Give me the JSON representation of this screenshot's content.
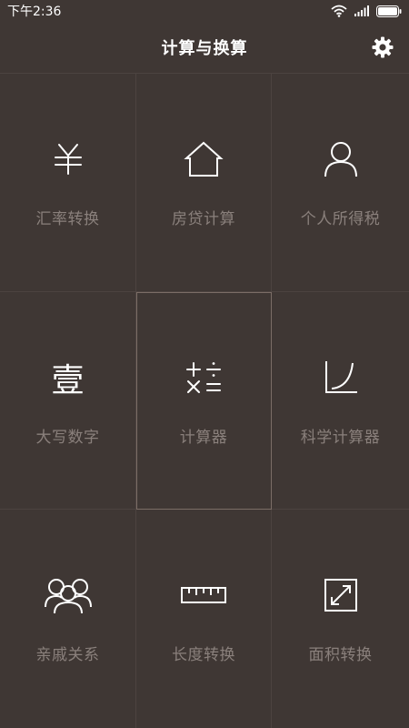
{
  "status_bar": {
    "time": "下午2:36",
    "icons": [
      "wifi-icon",
      "signal-icon",
      "battery-icon"
    ]
  },
  "header": {
    "title": "计算与换算",
    "settings_icon": "gear-icon"
  },
  "tiles": [
    {
      "label": "汇率转换",
      "icon": "yuan-icon"
    },
    {
      "label": "房贷计算",
      "icon": "house-icon"
    },
    {
      "label": "个人所得税",
      "icon": "person-icon"
    },
    {
      "label": "大写数字",
      "icon": "capital-number-icon",
      "glyph": "壹"
    },
    {
      "label": "计算器",
      "icon": "calculator-icon",
      "selected": true
    },
    {
      "label": "科学计算器",
      "icon": "curve-graph-icon"
    },
    {
      "label": "亲戚关系",
      "icon": "family-icon"
    },
    {
      "label": "长度转换",
      "icon": "ruler-icon"
    },
    {
      "label": "面积转换",
      "icon": "expand-icon"
    }
  ],
  "colors": {
    "background": "#3f3734",
    "divider": "#4c4340",
    "label": "#8a807c",
    "icon": "#ffffff",
    "selected_outline": "#7b6d66"
  }
}
